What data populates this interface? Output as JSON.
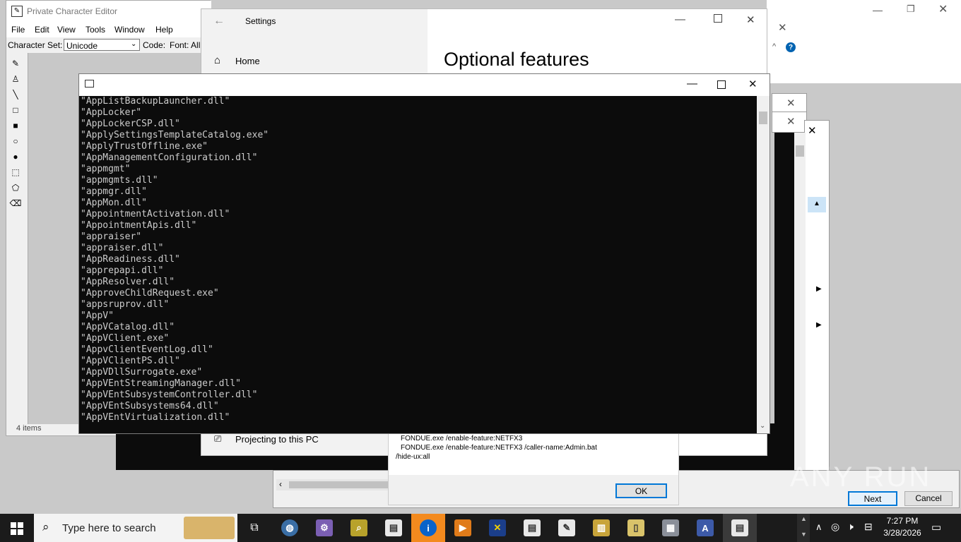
{
  "background_window": {
    "title": "Private Character Editor",
    "menu": [
      "File",
      "Edit",
      "View",
      "Tools",
      "Window",
      "Help"
    ],
    "character_set_label": "Character Set:",
    "character_set_value": "Unicode",
    "code_label": "Code:",
    "font_label": "Font: All",
    "status": "4 items"
  },
  "settings_window": {
    "title": "Settings",
    "home_label": "Home",
    "heading": "Optional features",
    "projecting_label": "Projecting to this PC"
  },
  "dialog": {
    "lines": [
      "FONDUE.exe /enable-feature:NETFX3",
      "FONDUE.exe /enable-feature:NETFX3 /caller-name:Admin.bat",
      "/hide-ux:all"
    ],
    "ok_label": "OK"
  },
  "wizard": {
    "next_label": "Next",
    "cancel_label": "Cancel"
  },
  "console": {
    "lines": [
      "\"AppListBackupLauncher.dll\"",
      "\"AppLocker\"",
      "\"AppLockerCSP.dll\"",
      "\"ApplySettingsTemplateCatalog.exe\"",
      "\"ApplyTrustOffline.exe\"",
      "\"AppManagementConfiguration.dll\"",
      "\"appmgmt\"",
      "\"appmgmts.dll\"",
      "\"appmgr.dll\"",
      "\"AppMon.dll\"",
      "\"AppointmentActivation.dll\"",
      "\"AppointmentApis.dll\"",
      "\"appraiser\"",
      "\"appraiser.dll\"",
      "\"AppReadiness.dll\"",
      "\"apprepapi.dll\"",
      "\"AppResolver.dll\"",
      "\"ApproveChildRequest.exe\"",
      "\"appsruprov.dll\"",
      "\"AppV\"",
      "\"AppVCatalog.dll\"",
      "\"AppVClient.exe\"",
      "\"AppvClientEventLog.dll\"",
      "\"AppVClientPS.dll\"",
      "\"AppVDllSurrogate.exe\"",
      "\"AppVEntStreamingManager.dll\"",
      "\"AppVEntSubsystemController.dll\"",
      "\"AppVEntSubsystems64.dll\"",
      "\"AppVEntVirtualization.dll\""
    ]
  },
  "taskbar": {
    "search_placeholder": "Type here to search",
    "time": "7:27 PM",
    "date": "3/28/2026"
  },
  "watermark": "ANY RUN",
  "colors": {
    "console_bg": "#0c0c0c",
    "console_fg": "#cccccc",
    "taskbar_bg": "#1b1b1b",
    "accent": "#0078d7"
  }
}
